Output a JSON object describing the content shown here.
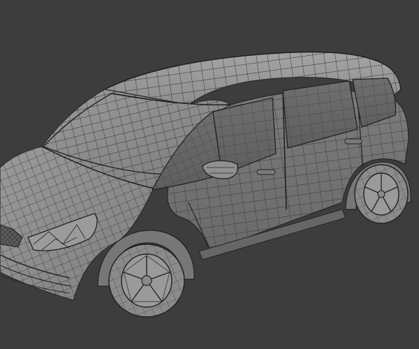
{
  "viewport": {
    "background_color": "#3d3d3d",
    "model": {
      "subject": "minivan",
      "render_mode": "wireframe-on-shaded",
      "surface_color": "#8c8c8c",
      "wire_color": "#2b2b2b"
    }
  }
}
